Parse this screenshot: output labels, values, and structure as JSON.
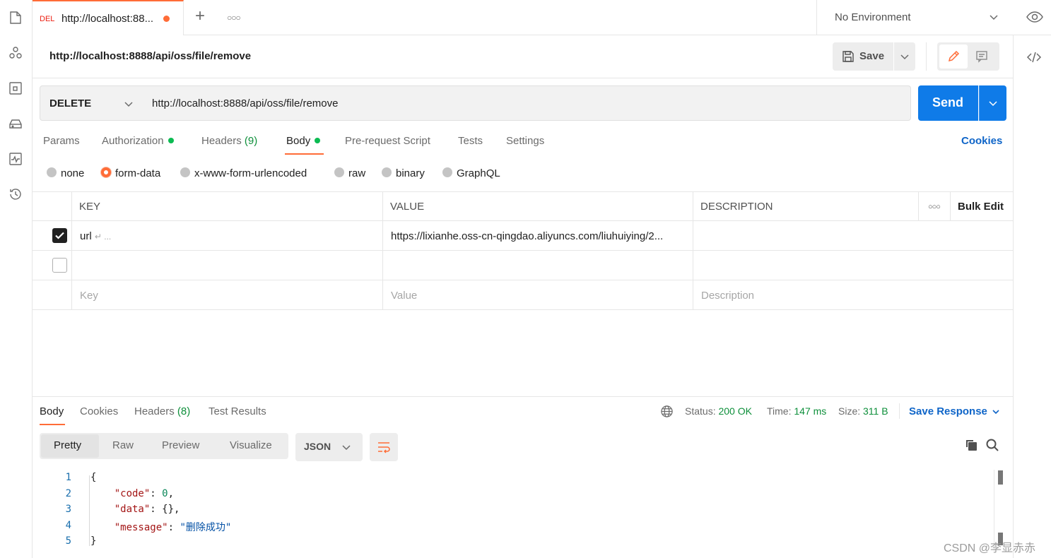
{
  "tab": {
    "method": "DEL",
    "title": "http://localhost:88..."
  },
  "environment": {
    "label": "No Environment"
  },
  "request": {
    "title": "http://localhost:8888/api/oss/file/remove",
    "method": "DELETE",
    "url": "http://localhost:8888/api/oss/file/remove",
    "save_label": "Save",
    "send_label": "Send"
  },
  "request_tabs": [
    {
      "label": "Params",
      "count": "",
      "dot": false
    },
    {
      "label": "Authorization",
      "count": "",
      "dot": true
    },
    {
      "label": "Headers",
      "count": "(9)",
      "dot": false
    },
    {
      "label": "Body",
      "count": "",
      "dot": true
    },
    {
      "label": "Pre-request Script",
      "count": "",
      "dot": false
    },
    {
      "label": "Tests",
      "count": "",
      "dot": false
    },
    {
      "label": "Settings",
      "count": "",
      "dot": false
    }
  ],
  "cookies_label": "Cookies",
  "body_types": [
    "none",
    "form-data",
    "x-www-form-urlencoded",
    "raw",
    "binary",
    "GraphQL"
  ],
  "body_type_selected": "form-data",
  "table": {
    "headers": {
      "key": "KEY",
      "value": "VALUE",
      "description": "DESCRIPTION",
      "bulk_edit": "Bulk Edit"
    },
    "rows": [
      {
        "checked": true,
        "key": "url",
        "key_suffix": "↵ ...",
        "value": "https://lixianhe.oss-cn-qingdao.aliyuncs.com/liuhuiying/2...",
        "description": ""
      },
      {
        "checked": false,
        "key": "",
        "key_suffix": "",
        "value": "",
        "description": ""
      }
    ],
    "placeholders": {
      "key": "Key",
      "value": "Value",
      "description": "Description"
    }
  },
  "response": {
    "tabs": [
      {
        "label": "Body",
        "count": ""
      },
      {
        "label": "Cookies",
        "count": ""
      },
      {
        "label": "Headers",
        "count": "(8)"
      },
      {
        "label": "Test Results",
        "count": ""
      }
    ],
    "status_label": "Status:",
    "status_value": "200 OK",
    "time_label": "Time:",
    "time_value": "147 ms",
    "size_label": "Size:",
    "size_value": "311 B",
    "save_response_label": "Save Response",
    "views": [
      "Pretty",
      "Raw",
      "Preview",
      "Visualize"
    ],
    "format": "JSON",
    "code_lines": [
      {
        "n": "1"
      },
      {
        "n": "2"
      },
      {
        "n": "3"
      },
      {
        "n": "4"
      },
      {
        "n": "5"
      }
    ],
    "json": {
      "open": "{",
      "code_key": "\"code\"",
      "code_val": "0",
      "data_key": "\"data\"",
      "data_val": "{}",
      "message_key": "\"message\"",
      "message_val": "\"删除成功\"",
      "close": "}"
    }
  },
  "watermark": "CSDN @李显赤赤",
  "colors": {
    "accent": "#ff6c37",
    "send": "#0f7be8",
    "link": "#0f65c8",
    "status_ok": "#0d8f3a",
    "method_delete": "#eb2013"
  }
}
